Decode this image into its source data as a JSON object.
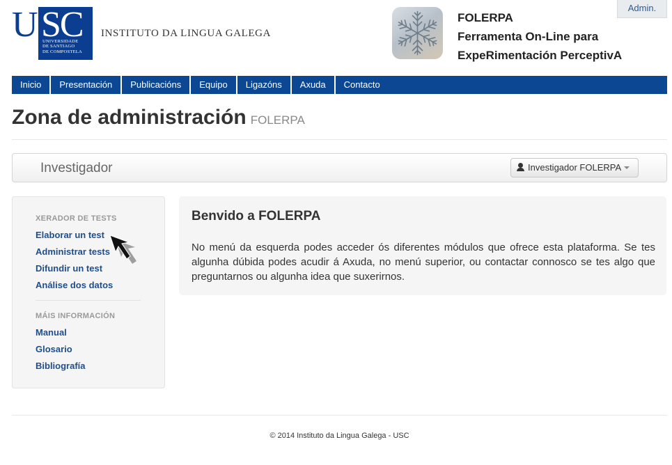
{
  "header": {
    "usc_logo": {
      "letter_u": "U",
      "letters_sc": "SC",
      "subtitle_lines": [
        "UNIVERSIDADE",
        "DE SANTIAGO",
        "DE COMPOSTELA"
      ]
    },
    "institute_name": "INSTITUTO DA LINGUA GALEGA",
    "app_title_lines": [
      "FOLERPA",
      "Ferramenta On-Line para",
      "ExpeRimentación PerceptivA"
    ],
    "admin_label": "Admin."
  },
  "nav": {
    "items": [
      {
        "label": "Inicio"
      },
      {
        "label": "Presentación"
      },
      {
        "label": "Publicacións"
      },
      {
        "label": "Equipo"
      },
      {
        "label": "Ligazóns"
      },
      {
        "label": "Axuda"
      },
      {
        "label": "Contacto"
      }
    ]
  },
  "page": {
    "title": "Zona de administración",
    "subtitle": "FOLERPA"
  },
  "role_bar": {
    "title": "Investigador",
    "user_menu_label": "Investigador FOLERPA"
  },
  "sidebar": {
    "sections": [
      {
        "header": "XERADOR DE TESTS",
        "links": [
          {
            "label": "Elaborar un test"
          },
          {
            "label": "Administrar tests"
          },
          {
            "label": "Difundir un test"
          },
          {
            "label": "Análise dos datos"
          }
        ]
      },
      {
        "header": "MÁIS INFORMACIÓN",
        "links": [
          {
            "label": "Manual"
          },
          {
            "label": "Glosario"
          },
          {
            "label": "Bibliografía"
          }
        ]
      }
    ]
  },
  "welcome": {
    "title": "Benvido a FOLERPA",
    "text": "No menú da esquerda podes acceder ós diferentes módulos que ofrece esta plataforma. Se tes algunha dúbida podes acudir á Axuda, no menú superior, ou contactar connosco se tes algo que preguntarnos ou algunha idea que suxerirnos."
  },
  "footer": {
    "text": "© 2014 Instituto da Lingua Galega - USC"
  },
  "colors": {
    "brand_blue": "#0c4793",
    "link_blue": "#1e4e8c"
  }
}
